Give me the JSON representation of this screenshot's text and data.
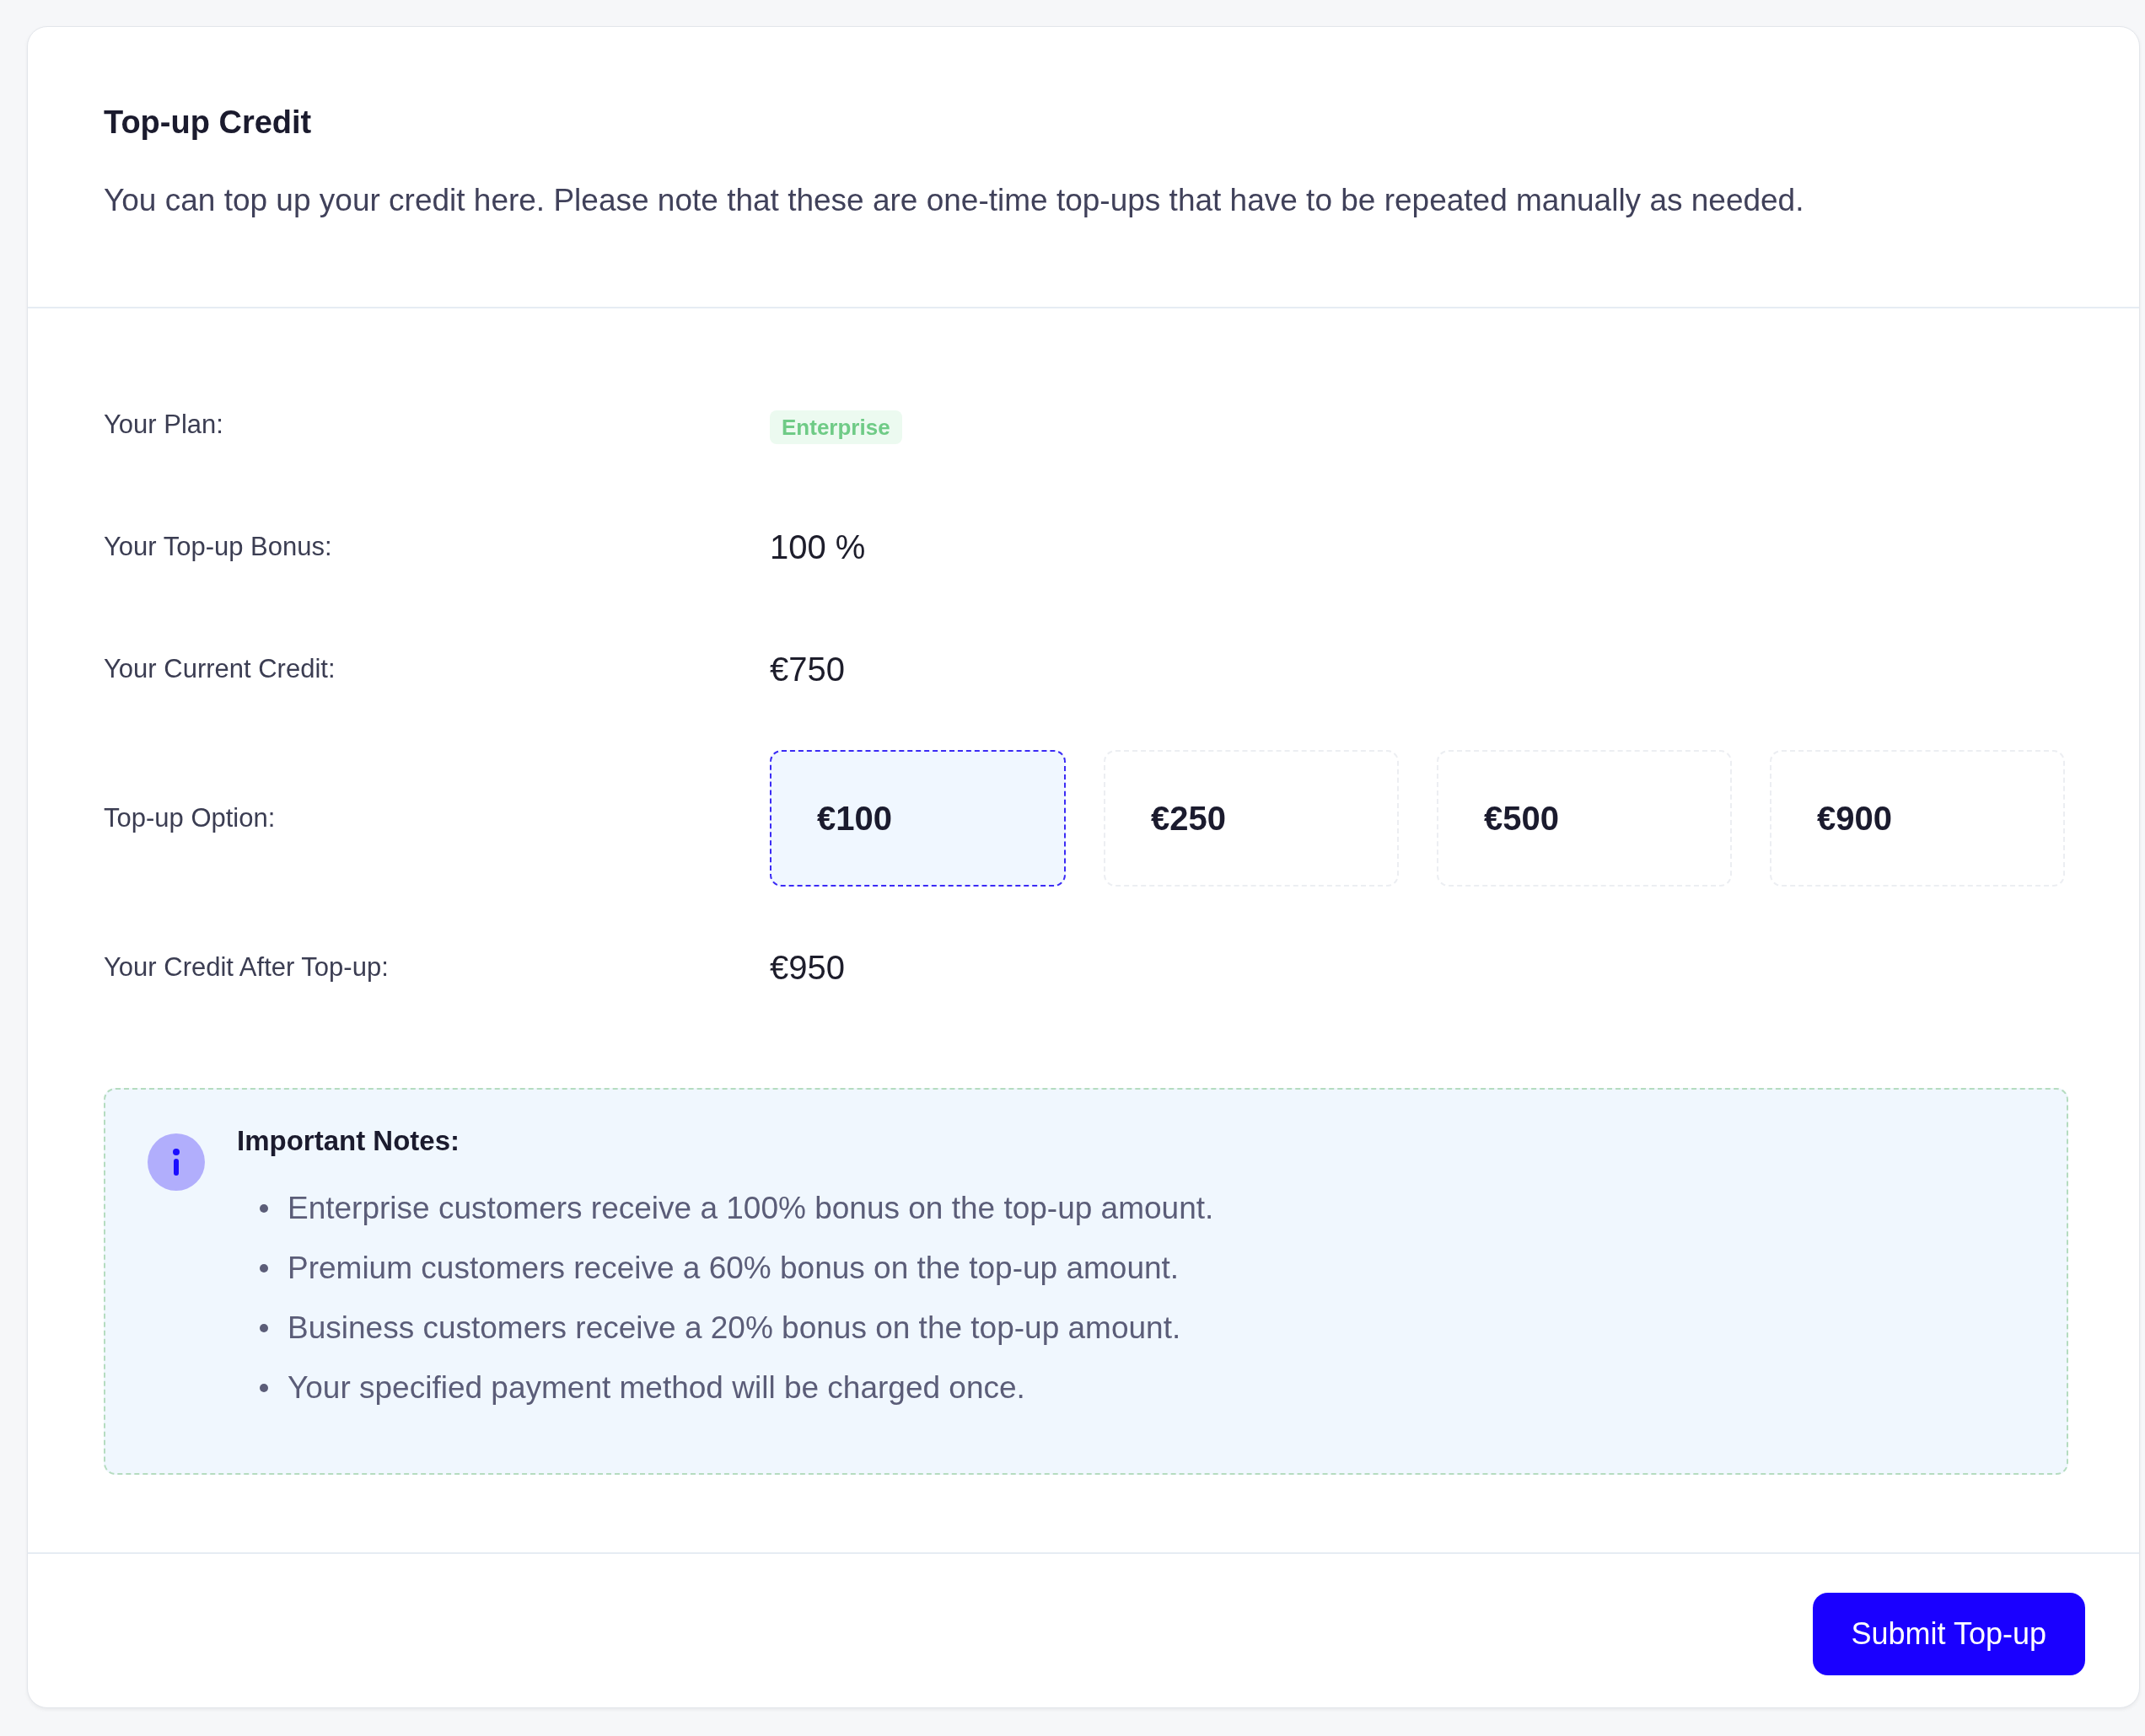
{
  "card": {
    "title": "Top-up Credit",
    "description": "You can top up your credit here. Please note that these are one-time top-ups that have to be repeated manually as needed."
  },
  "fields": [
    {
      "kind": "badge",
      "label": "Your Plan:",
      "value": "Enterprise"
    },
    {
      "kind": "text",
      "label": "Your Top-up Bonus:",
      "value": "100 %"
    },
    {
      "kind": "text",
      "label": "Your Current Credit:",
      "value": "€750"
    },
    {
      "kind": "options",
      "label": "Top-up Option:",
      "options": [
        {
          "label": "€100",
          "selected": true
        },
        {
          "label": "€250",
          "selected": false
        },
        {
          "label": "€500",
          "selected": false
        },
        {
          "label": "€900",
          "selected": false
        }
      ]
    },
    {
      "kind": "text",
      "label": "Your Credit After Top-up:",
      "value": "€950"
    }
  ],
  "notes": {
    "title": "Important Notes:",
    "items": [
      "Enterprise customers receive a 100% bonus on the top-up amount.",
      "Premium customers receive a 60% bonus on the top-up amount.",
      "Business customers receive a 20% bonus on the top-up amount.",
      "Your specified payment method will be charged once."
    ]
  },
  "submit_button": {
    "label": "Submit Top-up"
  }
}
